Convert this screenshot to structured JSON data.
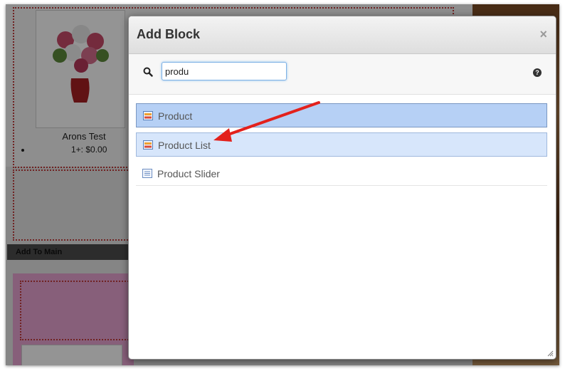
{
  "background": {
    "product_caption": "Arons Test",
    "price_line": "1+: $0.00",
    "add_to_main": "Add To Main"
  },
  "modal": {
    "title": "Add Block",
    "close_glyph": "×",
    "search_value": "produ",
    "help_glyph": "?"
  },
  "results": [
    {
      "label": "Product",
      "icon": "block-icon",
      "state": "selected"
    },
    {
      "label": "Product List",
      "icon": "block-icon",
      "state": "hover"
    },
    {
      "label": "Product Slider",
      "icon": "slider-icon",
      "state": "normal"
    }
  ],
  "annotation": {
    "arrow_color": "#e3211c"
  },
  "colors": {
    "selected_bg": "#b6d0f5",
    "hover_bg": "#d7e6fb",
    "dropzone_border": "#c23b3b"
  }
}
